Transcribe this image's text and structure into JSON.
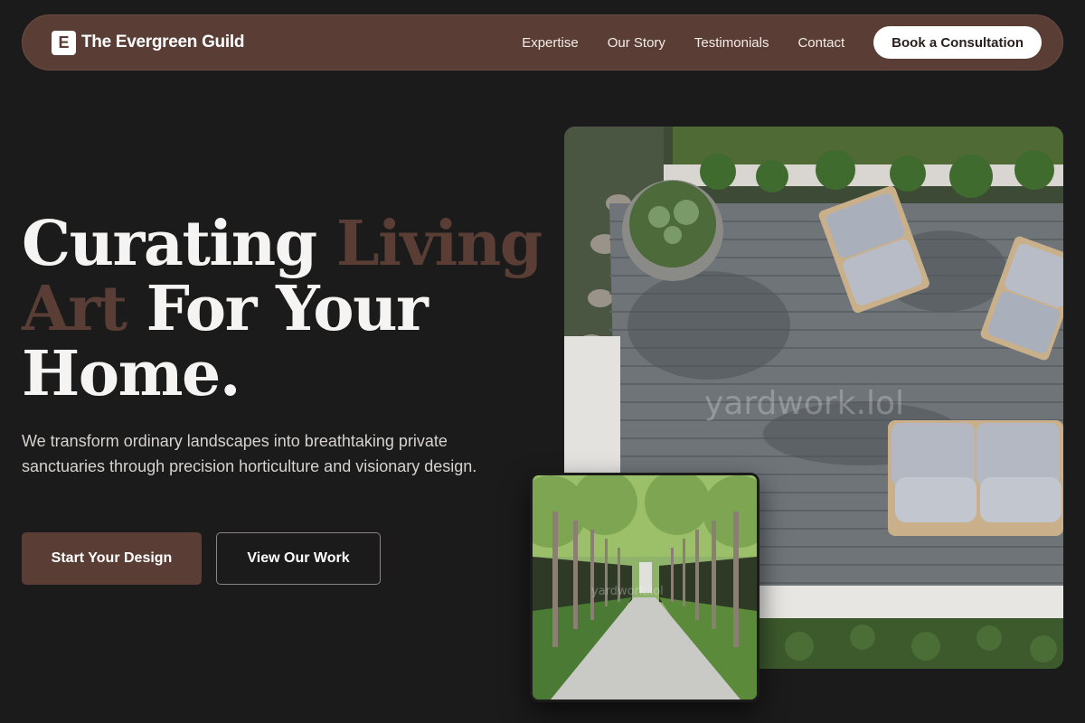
{
  "brand": {
    "logo_letter": "E",
    "name": "The Evergreen Guild"
  },
  "nav": {
    "links": [
      "Expertise",
      "Our Story",
      "Testimonials",
      "Contact"
    ],
    "cta": "Book a Consultation"
  },
  "hero": {
    "title_part1": "Curating ",
    "title_accent1": "Living",
    "title_accent2": "Art",
    "title_part2": " For Your Home.",
    "subtitle": "We transform ordinary landscapes into breathtaking private sanctuaries through precision horticulture and visionary design.",
    "primary_button": "Start Your Design",
    "secondary_button": "View Our Work"
  },
  "images": {
    "main_watermark": "yardwork.lol",
    "small_watermark": "yardwork.lol",
    "main_icon": "patio-deck-photo",
    "small_icon": "tree-lined-path-photo"
  },
  "colors": {
    "background": "#1c1b1b",
    "brand_brown": "#5a3e35",
    "white": "#ffffff"
  }
}
